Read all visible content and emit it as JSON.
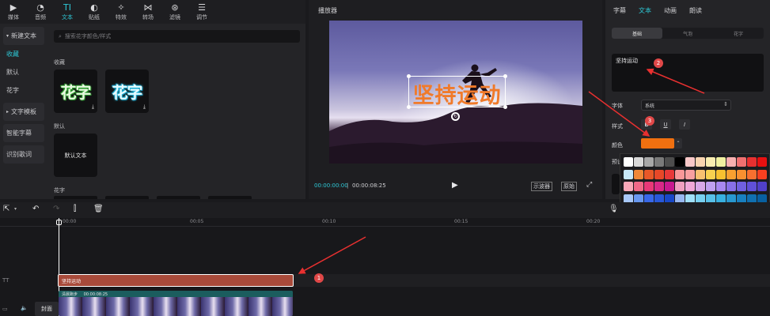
{
  "toolbar": {
    "items": [
      {
        "label": "媒体",
        "icon": "media-icon"
      },
      {
        "label": "音频",
        "icon": "audio-icon"
      },
      {
        "label": "文本",
        "icon": "text-icon",
        "active": true
      },
      {
        "label": "贴纸",
        "icon": "sticker-icon"
      },
      {
        "label": "特效",
        "icon": "effects-icon"
      },
      {
        "label": "转场",
        "icon": "transition-icon"
      },
      {
        "label": "滤镜",
        "icon": "filter-icon"
      },
      {
        "label": "调节",
        "icon": "adjust-icon"
      }
    ]
  },
  "sidebar": {
    "items": [
      {
        "label": "新建文本",
        "group": true
      },
      {
        "label": "收藏",
        "active": true
      },
      {
        "label": "默认"
      },
      {
        "label": "花字"
      },
      {
        "label": "文字模板",
        "group": true
      },
      {
        "label": "智能字幕"
      },
      {
        "label": "识别歌词"
      }
    ]
  },
  "assets": {
    "search_placeholder": "搜索花字颜色/样式",
    "favorites_label": "收藏",
    "card1_text": "花字",
    "card2_text": "花字",
    "default_label": "默认",
    "default_card_text": "默认文本",
    "huazi_label": "花字"
  },
  "player": {
    "title": "播放器",
    "overlay_text": "坚持运动",
    "current_time": "00:00:00:00",
    "total_time": "00:00:08:25",
    "scope_btn": "示波器",
    "original_btn": "原始"
  },
  "rpanel": {
    "tabs": [
      "字幕",
      "文本",
      "动画",
      "朗读"
    ],
    "subtabs": [
      "基础",
      "气泡",
      "花字"
    ],
    "text_value": "坚持运动",
    "font_label": "字体",
    "font_value": "系统",
    "style_label": "样式",
    "style_b": "B",
    "style_u": "U",
    "style_i": "I",
    "color_label": "颜色",
    "preset_label": "预设",
    "colors": {
      "selected": "#f07010",
      "accent": "#2ec8d6"
    }
  },
  "timeline": {
    "ticks": [
      "00:00",
      "00:05",
      "00:10",
      "00:15",
      "00:20"
    ],
    "text_clip": "坚持运动",
    "video_clip_label": "清晨跑步",
    "video_clip_time": "00:00:08:25",
    "cover_label": "封面",
    "track_text_icon": "TT"
  },
  "badges": [
    "1",
    "2",
    "3"
  ],
  "palette": {
    "rows": [
      [
        "#ffffff",
        "#d9d9d9",
        "#a8a8a8",
        "#7a7a7a",
        "#4d4d4d",
        "#000000",
        "#f8c8c8",
        "#f8d4b0",
        "#f8ecb0",
        "#f0f0a0",
        "#f8b0b0",
        "#f07070",
        "#e83030",
        "#e81010"
      ],
      [
        "#c8e8f8",
        "#f08838",
        "#e85828",
        "#e84828",
        "#e83838",
        "#f89898",
        "#f8a0a0",
        "#f8c070",
        "#f8d050",
        "#f8c030",
        "#f8a030",
        "#f89030",
        "#f87030",
        "#f84020"
      ],
      [
        "#f8a8b8",
        "#f06888",
        "#e83878",
        "#d82888",
        "#c81890",
        "#f0a0c0",
        "#f0a8d8",
        "#d8a8e8",
        "#c0a0f0",
        "#a888f0",
        "#8870e8",
        "#7060e0",
        "#6050d8",
        "#5040c8"
      ],
      [
        "#a8c8f8",
        "#6898f0",
        "#3868e8",
        "#2858d8",
        "#1848c8",
        "#98b8f0",
        "#a0e0f8",
        "#78d0f0",
        "#58c0e8",
        "#38b0e0",
        "#2898d0",
        "#1880c0",
        "#1070b0",
        "#0860a0"
      ],
      [
        "#a8f0c8",
        "#68e0a0",
        "#38d080",
        "#28c070",
        "#18b060",
        "#98e0b0",
        "#a8f0a8",
        "#88e088",
        "#68d068",
        "#48c048",
        "#38a838",
        "#289028",
        "#187818",
        "#106010"
      ],
      [
        "#d8d8b8",
        "#c8c8a0",
        "#b8b888",
        "#a8a870",
        "#989858",
        "#888840",
        "#a0d8d0",
        "#80c8c0",
        "#60b8b0",
        "#48a8a0",
        "#389890",
        "#288880",
        "#187870",
        "#106860"
      ],
      [
        "#f0e0a8",
        "#e0c880",
        "#d0b060",
        "#c09848",
        "#b08038",
        "#a07028",
        "#c8d0d8",
        "#a8b0c0",
        "#8890a8",
        "#687090",
        "#505878",
        "#404060",
        "#303048",
        "#202030"
      ],
      [
        "#a8b8d0",
        "#8898b8",
        "#c8a8b8",
        "#b888a0",
        "#a06888"
      ]
    ]
  }
}
